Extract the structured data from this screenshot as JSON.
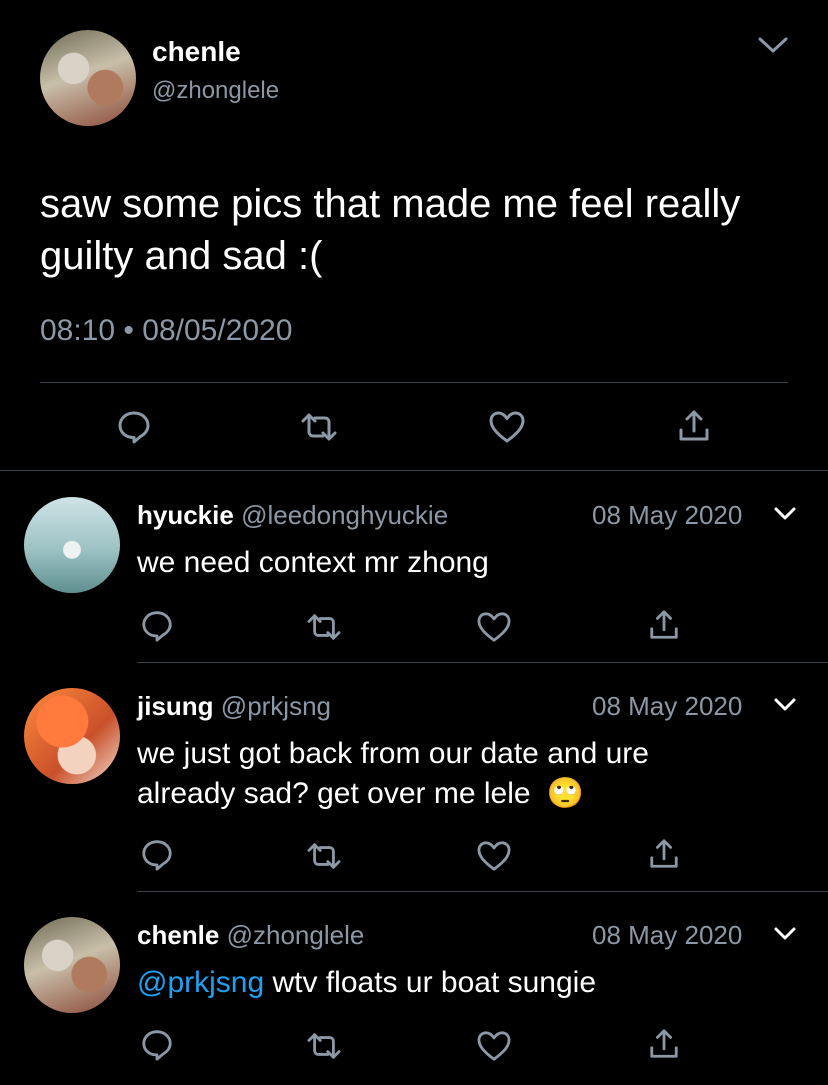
{
  "main_tweet": {
    "display_name": "chenle",
    "handle": "@zhonglele",
    "text": "saw some pics that made me feel really guilty and sad :(",
    "time": "08:10",
    "separator": "•",
    "date": "08/05/2020"
  },
  "replies": [
    {
      "display_name": "hyuckie",
      "handle": "@leedonghyuckie",
      "date": "08 May 2020",
      "text": "we need context mr zhong"
    },
    {
      "display_name": "jisung",
      "handle": "@prkjsng",
      "date": "08 May 2020",
      "text_line1": "we just got back from our date and ure",
      "text_line2": "already sad? get over me lele",
      "emoji": "🙄"
    },
    {
      "display_name": "chenle",
      "handle": "@zhonglele",
      "date": "08 May 2020",
      "mention": "@prkjsng",
      "text": " wtv floats ur boat sungie"
    }
  ],
  "colors": {
    "background": "#000000",
    "text": "#ffffff",
    "secondary": "#8b98a5",
    "link": "#1da1f2",
    "divider": "#38444d"
  },
  "icons": [
    "reply-icon",
    "retweet-icon",
    "like-icon",
    "share-icon",
    "chevron-down-icon"
  ]
}
